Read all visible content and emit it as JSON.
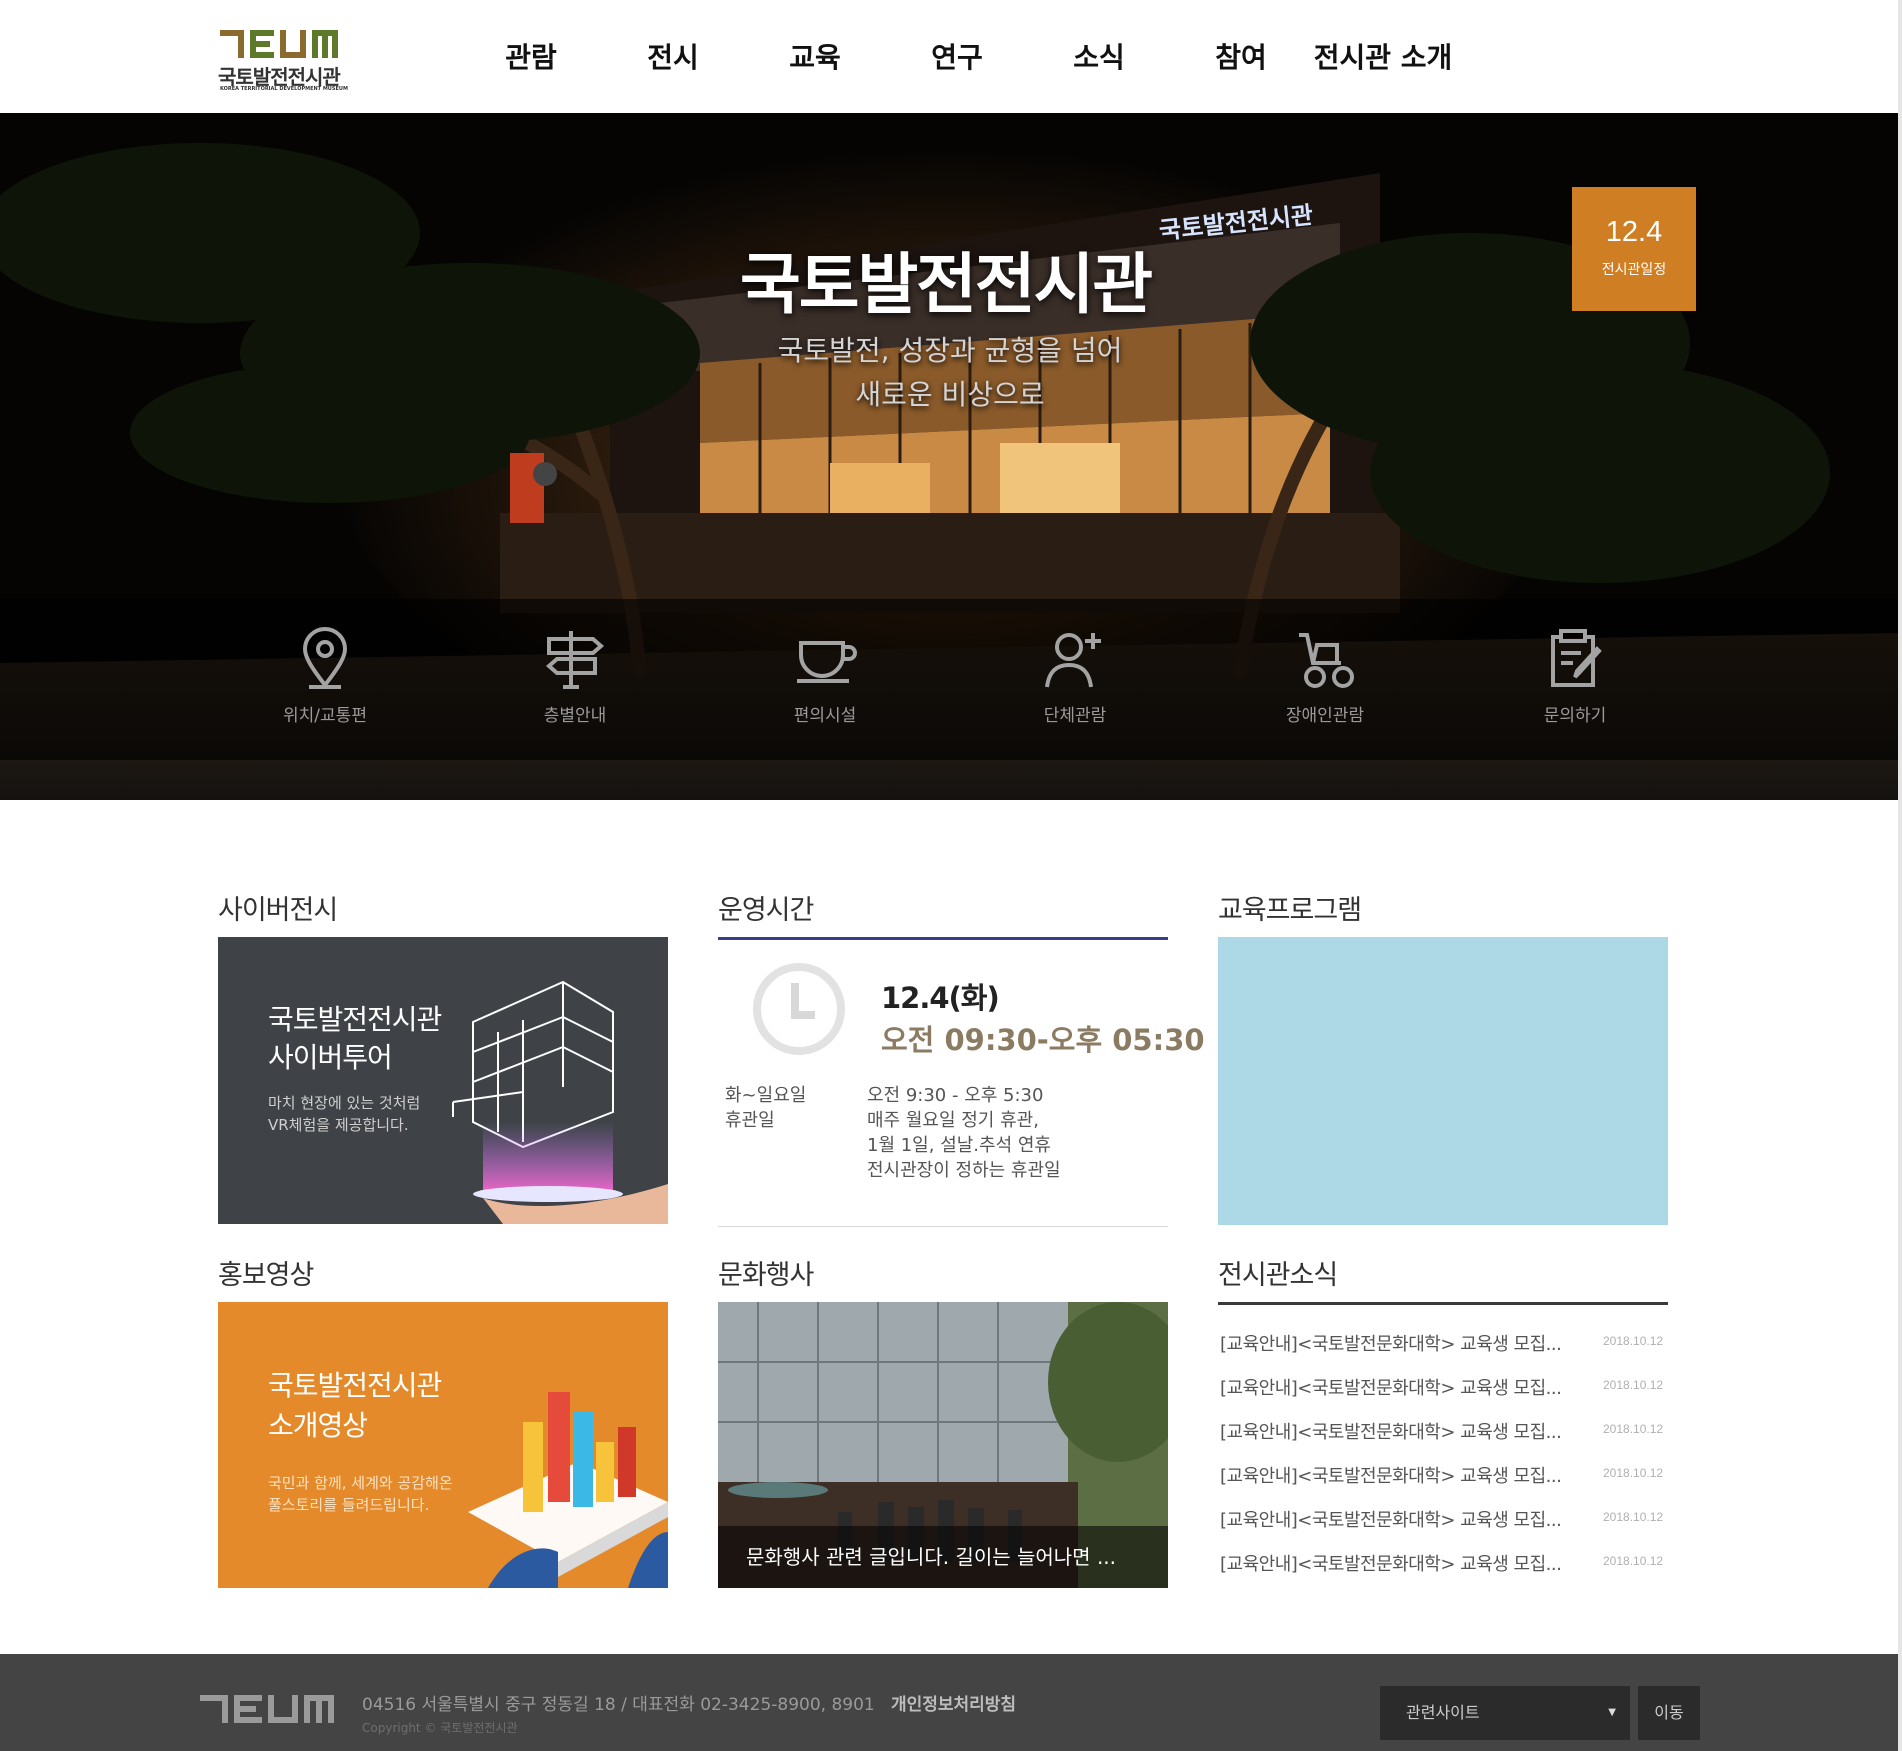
{
  "header": {
    "logo_ko": "국토발전전시관",
    "logo_en": "KOREA TERRITORIAL DEVELOPMENT MUSEUM",
    "nav": [
      "관람",
      "전시",
      "교육",
      "연구",
      "소식",
      "참여",
      "전시관 소개"
    ]
  },
  "hero": {
    "title": "국토발전전시관",
    "subtitle_line1": "국토발전, 성장과 균형을 넘어",
    "subtitle_line2": "새로운 비상으로",
    "sign_text": "국토발전전시관",
    "date_badge": {
      "date": "12.4",
      "label": "전시관일정"
    },
    "quick_links": [
      {
        "label": "위치/교통편",
        "icon": "map-pin-icon"
      },
      {
        "label": "층별안내",
        "icon": "signpost-icon"
      },
      {
        "label": "편의시설",
        "icon": "coffee-cup-icon"
      },
      {
        "label": "단체관람",
        "icon": "group-add-icon"
      },
      {
        "label": "장애인관람",
        "icon": "wheelchair-icon"
      },
      {
        "label": "문의하기",
        "icon": "inquiry-edit-icon"
      }
    ]
  },
  "sections": {
    "cyber": {
      "title": "사이버전시",
      "line1": "국토발전전시관",
      "line2": "사이버투어",
      "desc1": "마치 현장에 있는 것처럼",
      "desc2": "VR체험을 제공합니다."
    },
    "hours": {
      "title": "운영시간",
      "date": "12.4(화)",
      "time": "오전 09:30-오후 05:30",
      "label1": "화~일요일",
      "label2": "휴관일",
      "value1": "오전 9:30 - 오후 5:30",
      "value2": "매주 월요일 정기 휴관,",
      "value3": "1월 1일, 설날.추석 연휴",
      "value4": "전시관장이 정하는 휴관일",
      "accent": "#3a3d8f"
    },
    "edu": {
      "title": "교육프로그램",
      "color": "#add8e6"
    },
    "promo": {
      "title": "홍보영상",
      "line1": "국토발전전시관",
      "line2": "소개영상",
      "desc1": "국민과 함께, 세계와 공감해온",
      "desc2": "풀스토리를 들려드립니다.",
      "color": "#e48a2a"
    },
    "culture": {
      "title": "문화행사",
      "caption": "문화행사 관련 글입니다. 길이는 늘어나면 ..."
    },
    "news": {
      "title": "전시관소식",
      "items": [
        {
          "text": "[교육안내]<국토발전문화대학> 교육생 모집...",
          "date": "2018.10.12"
        },
        {
          "text": "[교육안내]<국토발전문화대학> 교육생 모집...",
          "date": "2018.10.12"
        },
        {
          "text": "[교육안내]<국토발전문화대학> 교육생 모집...",
          "date": "2018.10.12"
        },
        {
          "text": "[교육안내]<국토발전문화대학> 교육생 모집...",
          "date": "2018.10.12"
        },
        {
          "text": "[교육안내]<국토발전문화대학> 교육생 모집...",
          "date": "2018.10.12"
        },
        {
          "text": "[교육안내]<국토발전문화대학> 교육생 모집...",
          "date": "2018.10.12"
        }
      ]
    }
  },
  "footer": {
    "address": "04516 서울특별시 중구 정동길 18 / 대표전화 02-3425-8900, 8901",
    "privacy": "개인정보처리방침",
    "copyright": "Copyright © 국토발전전시관",
    "select_label": "관련사이트",
    "go_button": "이동"
  },
  "colors": {
    "brand_orange": "#cf7e24",
    "logo_brown": "#8b6a2e",
    "logo_green": "#5d7a2a",
    "footer_bg": "#444444"
  }
}
